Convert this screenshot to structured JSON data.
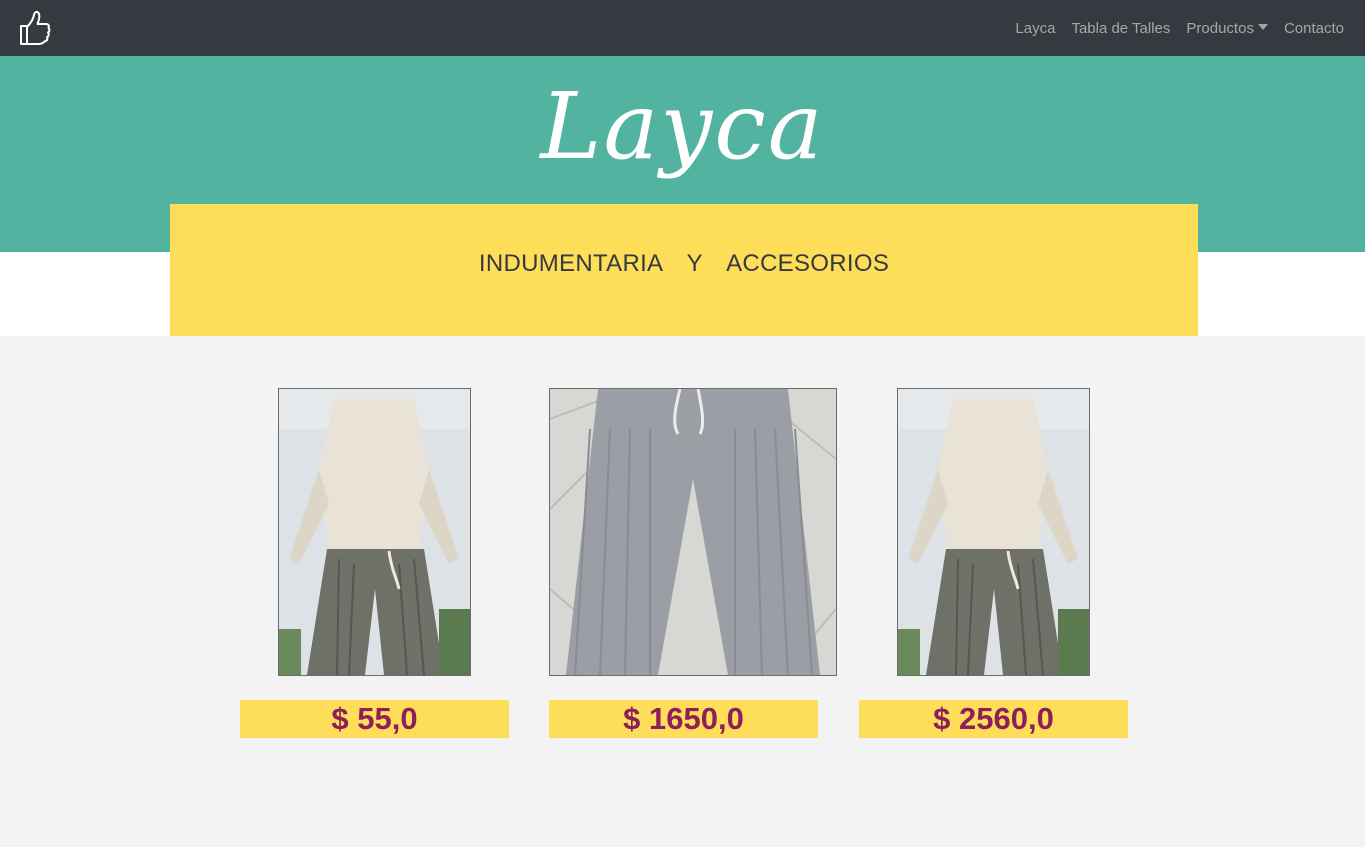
{
  "nav": {
    "brand_icon": "thumbs-up-icon",
    "links": [
      {
        "label": "Layca"
      },
      {
        "label": "Tabla de Talles"
      },
      {
        "label": "Productos"
      },
      {
        "label": "Contacto"
      }
    ]
  },
  "hero": {
    "logo_text": "Layca",
    "subtitle": "INDUMENTARIA Y ACCESORIOS"
  },
  "products": [
    {
      "image": "model-wearing-striped-pants-photo",
      "price": "$ 55,0"
    },
    {
      "image": "gray-ribbed-pants-photo",
      "price": "$ 1650,0"
    },
    {
      "image": "model-wearing-striped-pants-photo",
      "price": "$ 2560,0"
    }
  ],
  "colors": {
    "navbar": "#343a40",
    "hero": "#52b4a0",
    "accent_yellow": "#fedd58",
    "price_text": "#8e1f5a"
  }
}
